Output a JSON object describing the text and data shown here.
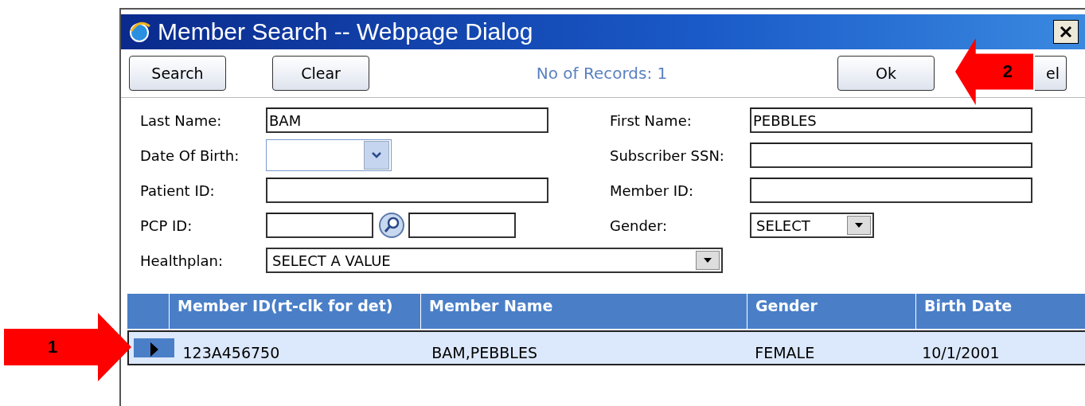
{
  "window": {
    "title": "Member Search -- Webpage Dialog"
  },
  "toolbar": {
    "left_buttons": [
      {
        "label": "Search"
      },
      {
        "label": "Clear"
      }
    ],
    "record_count": "No of Records: 1",
    "right_buttons": [
      {
        "label": "Ok"
      },
      {
        "label": "el"
      }
    ]
  },
  "form": {
    "fields": [
      {
        "label": "Last Name:",
        "kind": "text",
        "value": "BAM"
      },
      {
        "label": "First Name:",
        "kind": "text",
        "value": "PEBBLES"
      },
      {
        "label": "Date Of Birth:",
        "kind": "date"
      },
      {
        "label": "Subscriber SSN:",
        "kind": "text"
      },
      {
        "label": "Patient ID:",
        "kind": "text"
      },
      {
        "label": "Member ID:",
        "kind": "text"
      },
      {
        "label": "PCP ID:",
        "kind": "lookup"
      },
      {
        "label": "Gender:",
        "kind": "select",
        "value": "SELECT"
      },
      {
        "label": "Healthplan:",
        "kind": "wideselect",
        "value": "SELECT A VALUE"
      }
    ]
  },
  "table": {
    "columns": [
      "Member ID(rt-clk for det)",
      "Member Name",
      "Gender",
      "Birth Date"
    ],
    "rows": [
      {
        "selected": true,
        "cells": [
          "123A456750",
          "BAM,PEBBLES",
          "FEMALE",
          "10/1/2001"
        ]
      }
    ]
  },
  "callouts": [
    {
      "label": "1"
    },
    {
      "label": "2"
    }
  ]
}
